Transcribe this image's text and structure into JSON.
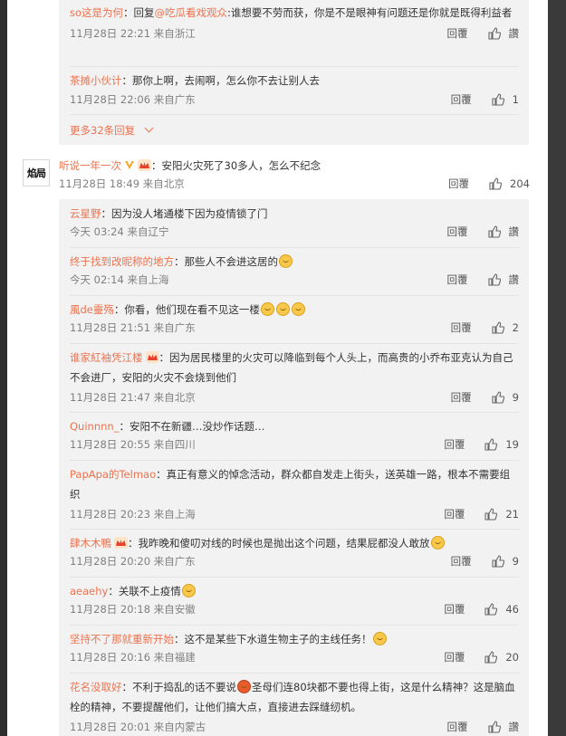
{
  "colors": {
    "accent": "#eb7350",
    "background": "#393939",
    "card": "#ffffff",
    "reply_box": "#f2f2f2"
  },
  "top_replies": [
    {
      "user": "so这是为何",
      "sep": "：",
      "prefix": "回复",
      "mention": "@吃瓜看戏观众",
      "text": ":谁想要不劳而获，你是不是眼神有问题还是你就是既得利益者",
      "time": "11月28日 22:21 来自浙江",
      "reply_label": "回覆",
      "likes": "讚"
    },
    {
      "user": "茶摊小伙计",
      "sep": "：",
      "text": "那你上啊，去闹啊，怎么你不去让别人去",
      "time": "11月28日 22:06 来自广东",
      "reply_label": "回覆",
      "likes": "1"
    }
  ],
  "more_replies": "更多32条回复",
  "main": {
    "avatar_text": "焰局",
    "user": "听说一年一次",
    "sep": "：",
    "text": "安阳火灾死了30多人，怎么不纪念",
    "time": "11月28日 18:49 来自北京",
    "reply_label": "回覆",
    "likes": "204"
  },
  "replies": [
    {
      "user": "云星野",
      "sep": "：",
      "text": "因为没人堵通楼下因为疫情锁了门",
      "time": "今天 03:24 来自辽宁",
      "reply_label": "回覆",
      "likes": "讚"
    },
    {
      "user": "终于找到改昵称的地方",
      "sep": "：",
      "text": "那些人不会进这居的",
      "time": "今天 02:14 来自上海",
      "reply_label": "回覆",
      "likes": "讚",
      "emojis": 1
    },
    {
      "user": "風de靈殇",
      "sep": "：",
      "text": "你看，他们现在看不见这一楼",
      "time": "11月28日 21:51 来自广东",
      "reply_label": "回覆",
      "likes": "2",
      "emojis": 3
    },
    {
      "user": "谁家紅袖凭江楼",
      "sep": "：",
      "text": "因为居民楼里的火灾可以降临到每个人头上，而高贵的小乔布亚克认为自己不会进厂，安阳的火灾不会烧到他们",
      "time": "11月28日 21:47 来自北京",
      "reply_label": "回覆",
      "likes": "9"
    },
    {
      "user": "Quinnnn_",
      "sep": "：",
      "text": "安阳不在新疆…没炒作话题…",
      "time": "11月28日 20:55 来自四川",
      "reply_label": "回覆",
      "likes": "19"
    },
    {
      "user": "PapApa的Telmao",
      "sep": "：",
      "text": "真正有意义的悼念活动，群众都自发走上街头，送英雄一路，根本不需要组织",
      "time": "11月28日 20:23 来自上海",
      "reply_label": "回覆",
      "likes": "21"
    },
    {
      "user": "肆木木鴨",
      "sep": "：",
      "text": "我昨晚和傻叨对线的时候也是抛出这个问题，结果屁都没人敢放",
      "time": "11月28日 20:20 来自广东",
      "reply_label": "回覆",
      "likes": "9",
      "emojis": 1
    },
    {
      "user": "aeaehy",
      "sep": "：",
      "text": "关联不上疫情",
      "time": "11月28日 20:18 来自安徽",
      "reply_label": "回覆",
      "likes": "46",
      "emojis": 1
    },
    {
      "user": "坚持不了那就重新开始",
      "sep": "：",
      "text": "这不是某些下水道生物主子的主线任务！",
      "time": "11月28日 20:16 来自福建",
      "reply_label": "回覆",
      "likes": "20",
      "emojis": 1
    },
    {
      "user": "花名没取好",
      "sep": "：",
      "text_a": "不利于捣乱的话不要说",
      "text_b": "圣母们连80块都不要也得上街，这是什么精神？这是脑血栓的精神，不要提醒他们，让他们搞大点，直接进去踩缝纫机。",
      "time": "11月28日 20:01 来自内蒙古",
      "reply_label": "回覆",
      "likes": "讚"
    }
  ]
}
